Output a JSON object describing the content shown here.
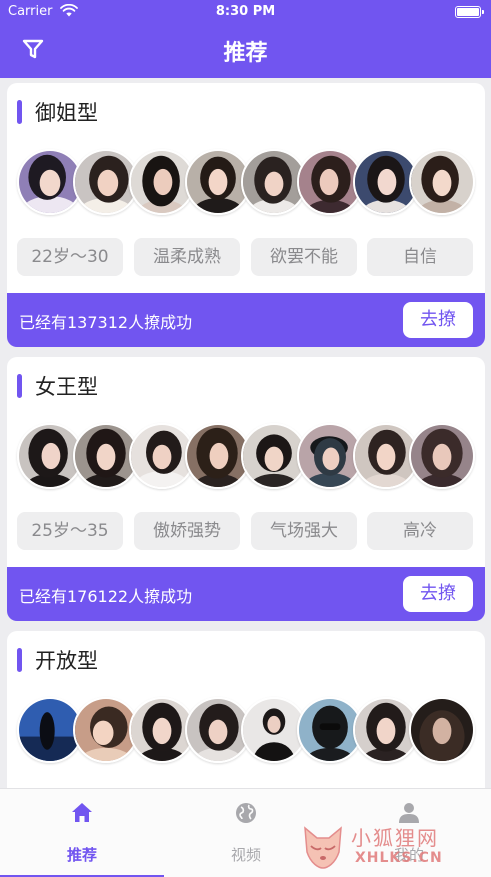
{
  "status_bar": {
    "carrier": "Carrier",
    "time": "8:30 PM"
  },
  "nav": {
    "title": "推荐",
    "filter_icon": "filter-icon"
  },
  "cards": [
    {
      "title": "御姐型",
      "tags": [
        "22岁～30",
        "温柔成熟",
        "欲罢不能",
        "自信"
      ],
      "success_text": "已经有137312人撩成功",
      "button_label": "去撩"
    },
    {
      "title": "女王型",
      "tags": [
        "25岁～35",
        "傲娇强势",
        "气场强大",
        "高冷"
      ],
      "success_text": "已经有176122人撩成功",
      "button_label": "去撩"
    },
    {
      "title": "开放型",
      "tags": [],
      "success_text": "",
      "button_label": ""
    }
  ],
  "tabs": [
    {
      "label": "推荐",
      "icon": "home-icon",
      "active": true
    },
    {
      "label": "视频",
      "icon": "globe-icon",
      "active": false
    },
    {
      "label": "我的",
      "icon": "person-icon",
      "active": false
    }
  ],
  "watermark": {
    "line1": "小狐狸网",
    "line2": "XHLKS.CN"
  },
  "colors": {
    "accent": "#7155f0",
    "tag_bg": "#eeeeef",
    "tag_text": "#8a8a8d",
    "tab_inactive": "#a8a8ac"
  }
}
